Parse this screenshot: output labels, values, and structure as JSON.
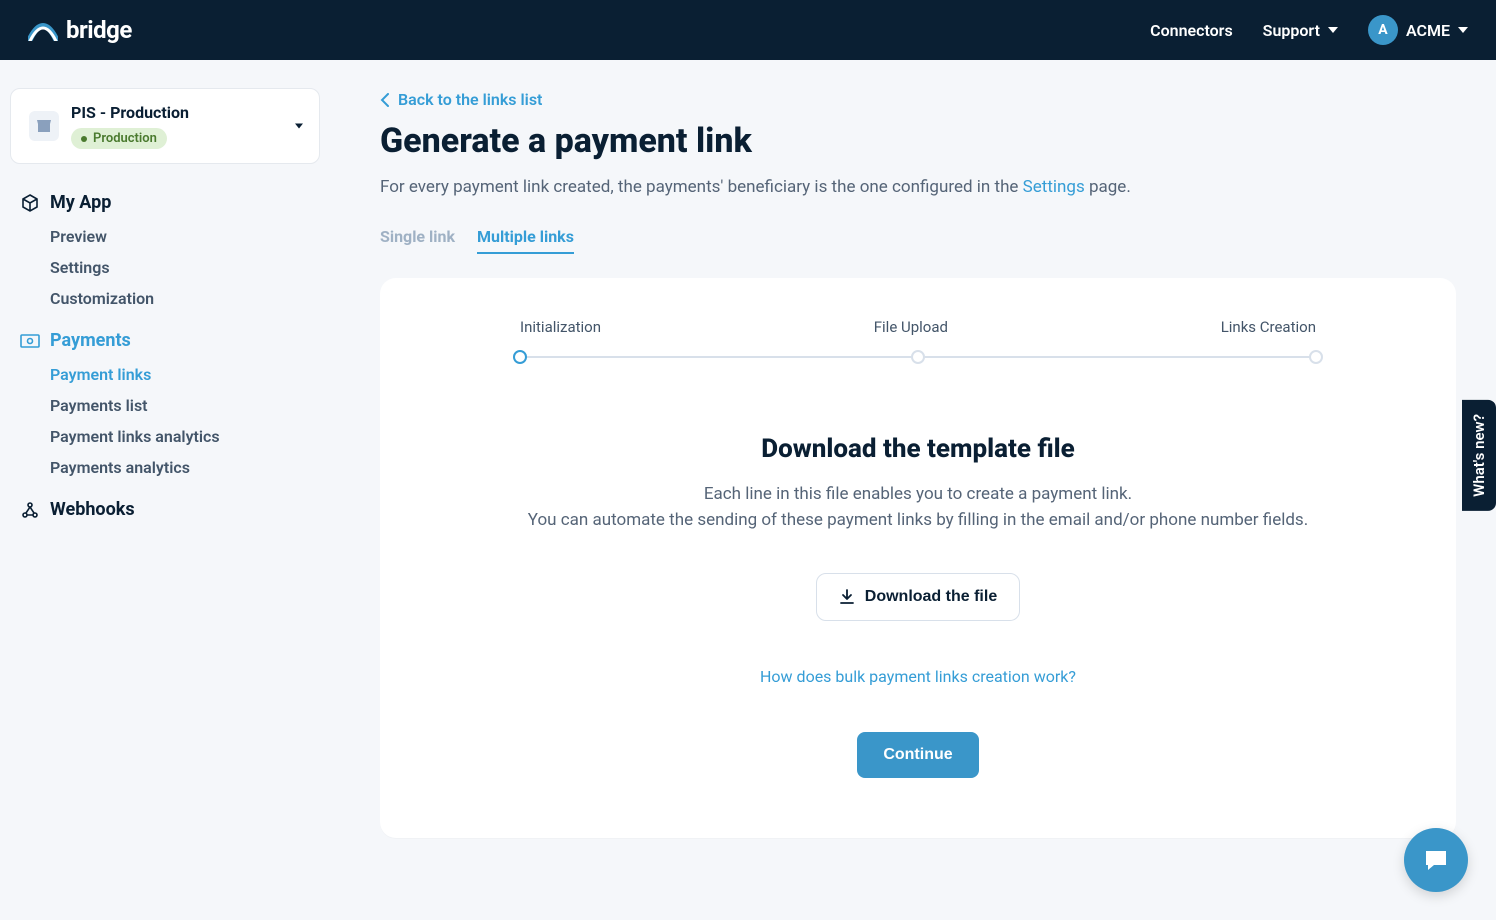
{
  "header": {
    "brand": "bridge",
    "connectors": "Connectors",
    "support": "Support",
    "org_initial": "A",
    "org_name": "ACME"
  },
  "sidebar": {
    "app_selector": {
      "name": "PIS - Production",
      "env_label": "Production"
    },
    "section_my_app": {
      "title": "My App",
      "items": {
        "preview": "Preview",
        "settings": "Settings",
        "customization": "Customization"
      }
    },
    "section_payments": {
      "title": "Payments",
      "items": {
        "payment_links": "Payment links",
        "payments_list": "Payments list",
        "payment_links_analytics": "Payment links analytics",
        "payments_analytics": "Payments analytics"
      }
    },
    "section_webhooks": {
      "title": "Webhooks"
    }
  },
  "main": {
    "back_label": "Back to the links list",
    "title": "Generate a payment link",
    "description_pre": "For every payment link created, the payments' beneficiary is the one configured in the ",
    "description_link": "Settings",
    "description_post": " page.",
    "tabs": {
      "single": "Single link",
      "multiple": "Multiple links"
    },
    "stepper": {
      "step1": "Initialization",
      "step2": "File Upload",
      "step3": "Links Creation"
    },
    "panel": {
      "heading": "Download the template file",
      "line1": "Each line in this file enables you to create a payment link.",
      "line2": "You can automate the sending of these payment links by filling in the email and/or phone number fields.",
      "download_button": "Download the file",
      "help": "How does bulk payment links creation work?",
      "continue": "Continue"
    }
  },
  "side_tab": "What's new?",
  "colors": {
    "accent": "#359dd6",
    "dark": "#0a1f33"
  }
}
